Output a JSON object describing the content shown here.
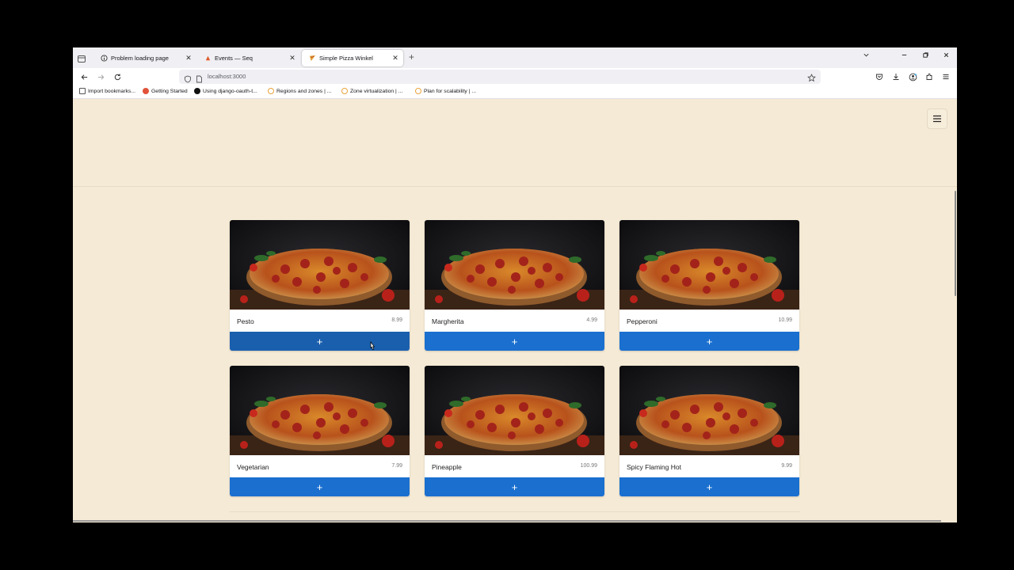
{
  "browser": {
    "tabs": [
      {
        "title": "Problem loading page",
        "favicon": "info-icon",
        "active": false
      },
      {
        "title": "Events — Seq",
        "favicon": "seq-icon",
        "active": false
      },
      {
        "title": "Simple Pizza Winkel",
        "favicon": "pizza-icon",
        "active": true
      }
    ],
    "url": "localhost:3000",
    "bookmarks": [
      {
        "label": "Import bookmarks...",
        "icon": "import-icon",
        "color": "#555555"
      },
      {
        "label": "Getting Started",
        "icon": "firefox-icon",
        "color": "#e0533a"
      },
      {
        "label": "Using django-oauth-t...",
        "icon": "github-icon",
        "color": "#111111"
      },
      {
        "label": "Regions and zones | ...",
        "icon": "cloud-icon",
        "color": "#e8a33a"
      },
      {
        "label": "Zone virtualization | ...",
        "icon": "cloud-icon",
        "color": "#e8a33a"
      },
      {
        "label": "Plan for scalability | ...",
        "icon": "cloud-icon",
        "color": "#e8a33a"
      }
    ]
  },
  "accent_color": "#1a6fcf",
  "background_color": "#f5ead5",
  "products": [
    {
      "name": "Pesto",
      "price": "8.99",
      "add_label": "+"
    },
    {
      "name": "Margherita",
      "price": "4.99",
      "add_label": "+"
    },
    {
      "name": "Pepperoni",
      "price": "10.99",
      "add_label": "+"
    },
    {
      "name": "Vegetarian",
      "price": "7.99",
      "add_label": "+"
    },
    {
      "name": "Pineapple",
      "price": "100.99",
      "add_label": "+"
    },
    {
      "name": "Spicy Flaming Hot",
      "price": "9.99",
      "add_label": "+"
    }
  ]
}
